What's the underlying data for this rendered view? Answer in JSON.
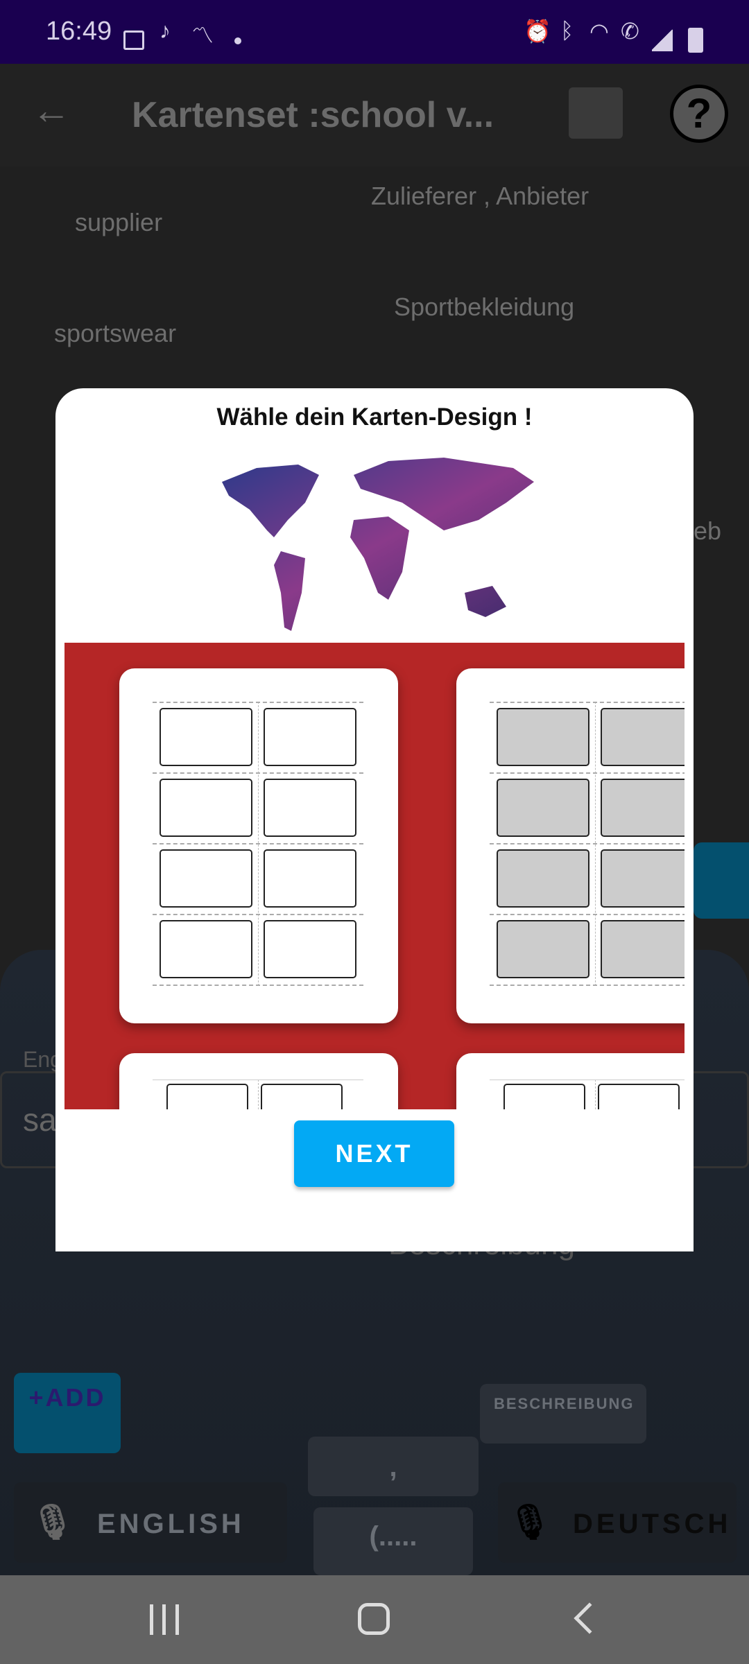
{
  "status_bar": {
    "time": "16:49",
    "icons": [
      "gallery-icon",
      "tiktok-icon",
      "chart-icon",
      "dot-icon",
      "alarm-icon",
      "bluetooth-icon",
      "wifi-icon",
      "wifi-call-icon",
      "signal-icon",
      "battery-icon"
    ]
  },
  "app_bar": {
    "title": "Kartenset :school v...",
    "back_icon": "arrow-left-icon",
    "print_icon": "printer-icon",
    "help_icon": "help-icon"
  },
  "background": {
    "rows": [
      {
        "english": "supplier",
        "german": "Zulieferer ,  Anbieter"
      },
      {
        "english": "sportswear",
        "german": "Sportbekleidung"
      }
    ],
    "partial_text": "eb",
    "english_field": {
      "label": "Eng",
      "value": "sa"
    },
    "description_placeholder": "Beschreibung",
    "add_button": "+ADD",
    "description_button": "BESCHREIBUNG",
    "comma_key": ",",
    "dots_key": "(.....",
    "english_button": "ENGLISH",
    "deutsch_button": "DEUTSCH"
  },
  "dialog": {
    "title": "Wähle dein Karten-Design !",
    "designs": [
      {
        "style": "white"
      },
      {
        "style": "grey"
      },
      {
        "style": "white-small"
      },
      {
        "style": "white-small"
      }
    ],
    "next_label": "NEXT",
    "colors": {
      "accent": "#03a9f4",
      "panel": "#b52626"
    }
  },
  "nav_bar": {
    "icons": [
      "recent-apps-icon",
      "home-icon",
      "back-icon"
    ]
  }
}
